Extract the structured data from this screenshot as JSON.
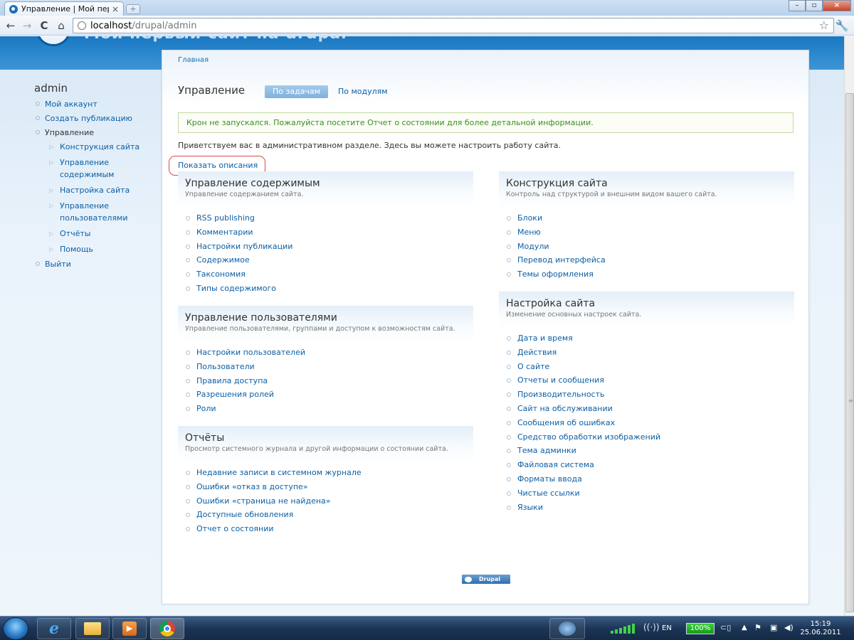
{
  "browser": {
    "tab_title": "Управление | Мой первый",
    "tab_close": "×",
    "new_tab": "+",
    "url_host": "localhost",
    "url_path": "/drupal/admin",
    "win_minimize": "–",
    "win_maximize": "▫",
    "win_close": "×",
    "back_icon": "←",
    "forward_icon": "→",
    "reload_icon": "C",
    "home_icon": "⌂",
    "star_icon": "☆",
    "wrench_icon": "🔧"
  },
  "site": {
    "name": "Мой первый сайт на drupal"
  },
  "sidebar": {
    "user": "admin",
    "items": [
      {
        "label": "Мой аккаунт"
      },
      {
        "label": "Создать публикацию"
      },
      {
        "label": "Управление"
      }
    ],
    "sub_items": [
      {
        "label": "Конструкция сайта"
      },
      {
        "label": "Управление содержимым"
      },
      {
        "label": "Настройка сайта"
      },
      {
        "label": "Управление пользователями"
      },
      {
        "label": "Отчёты"
      },
      {
        "label": "Помощь"
      }
    ],
    "logout": "Выйти"
  },
  "main": {
    "breadcrumb": "Главная",
    "title": "Управление",
    "tab_by_task": "По задачам",
    "tab_by_module": "По модулям",
    "status_message": "Крон не запускался. Пожалуйста посетите Отчет о состоянии для более детальной информации.",
    "welcome": "Приветствуем вас в административном разделе. Здесь вы можете настроить работу сайта.",
    "show_descriptions": "Показать описания",
    "blocks": {
      "content": {
        "title": "Управление содержимым",
        "desc": "Управление содержанием сайта.",
        "links": [
          "RSS publishing",
          "Комментарии",
          "Настройки публикации",
          "Содержимое",
          "Таксономия",
          "Типы содержимого"
        ]
      },
      "users": {
        "title": "Управление пользователями",
        "desc": "Управление пользователями, группами и доступом к возможностям сайта.",
        "links": [
          "Настройки пользователей",
          "Пользователи",
          "Правила доступа",
          "Разрешения ролей",
          "Роли"
        ]
      },
      "reports": {
        "title": "Отчёты",
        "desc": "Просмотр системного журнала и другой информации о состоянии сайта.",
        "links": [
          "Недавние записи в системном журнале",
          "Ошибки «отказ в доступе»",
          "Ошибки «страница не найдена»",
          "Доступные обновления",
          "Отчет о состоянии"
        ]
      },
      "build": {
        "title": "Конструкция сайта",
        "desc": "Контроль над структурой и внешним видом вашего сайта.",
        "links": [
          "Блоки",
          "Меню",
          "Модули",
          "Перевод интерфейса",
          "Темы оформления"
        ]
      },
      "config": {
        "title": "Настройка сайта",
        "desc": "Изменение основных настроек сайта.",
        "links": [
          "Дата и время",
          "Действия",
          "О сайте",
          "Отчеты и сообщения",
          "Производительность",
          "Сайт на обслуживании",
          "Сообщения об ошибках",
          "Средство обработки изображений",
          "Тема админки",
          "Файловая система",
          "Форматы ввода",
          "Чистые ссылки",
          "Языки"
        ]
      }
    },
    "footer_badge": "Drupal"
  },
  "taskbar": {
    "media_glyph": "▶",
    "lang": "EN",
    "battery": "100%",
    "time": "15:19",
    "date": "25.06.2011",
    "wifi_glyph": "((·))",
    "plug_glyph": "⊂▯",
    "tray_arrow": "▲",
    "flag_glyph": "⚑",
    "screen_glyph": "▣",
    "volume_glyph": "◀)"
  }
}
